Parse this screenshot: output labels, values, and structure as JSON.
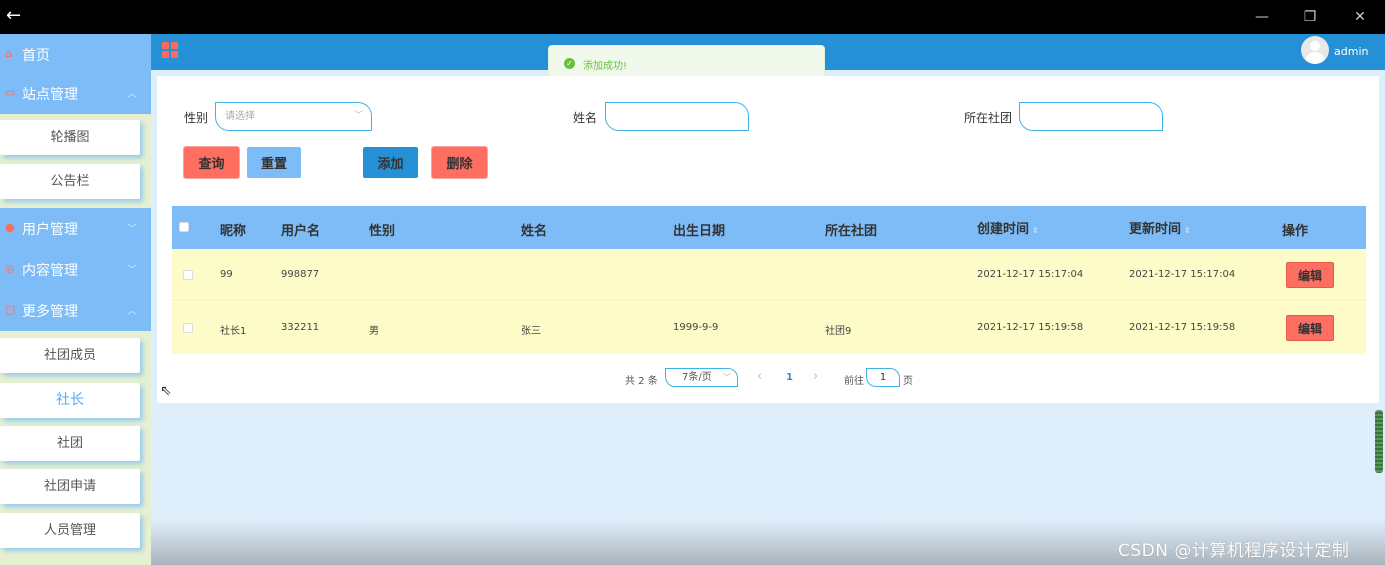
{
  "window": {
    "back_icon": "arrow-left-icon",
    "minimize": "—",
    "restore": "❐",
    "close": "✕"
  },
  "sidebar": {
    "groups": [
      {
        "label": "首页",
        "icon": "home-icon"
      },
      {
        "label": "站点管理",
        "icon": "monitor-icon",
        "items": [
          "轮播图",
          "公告栏"
        ]
      },
      {
        "label": "用户管理",
        "icon": "user-icon"
      },
      {
        "label": "内容管理",
        "icon": "content-icon"
      },
      {
        "label": "更多管理",
        "icon": "more-icon",
        "items": [
          "社团成员",
          "社长",
          "社团",
          "社团申请",
          "人员管理"
        ]
      }
    ],
    "active_item": "社长"
  },
  "header": {
    "username": "admin",
    "menu_icon": "grid-icon"
  },
  "toast": {
    "message": "添加成功!",
    "type": "success"
  },
  "filters": {
    "gender_label": "性别",
    "gender_placeholder": "请选择",
    "name_label": "姓名",
    "name_value": "",
    "club_label": "所在社团",
    "club_value": ""
  },
  "buttons": {
    "query": "查询",
    "reset": "重置",
    "add": "添加",
    "delete": "删除"
  },
  "table": {
    "headers": [
      "昵称",
      "用户名",
      "性别",
      "姓名",
      "出生日期",
      "所在社团",
      "创建时间",
      "更新时间",
      "操作"
    ],
    "rows": [
      [
        "99",
        "998877",
        "",
        "",
        "",
        "",
        "2021-12-17 15:17:04",
        "2021-12-17 15:17:04"
      ],
      [
        "社长1",
        "332211",
        "男",
        "张三",
        "1999-9-9",
        "社团9",
        "2021-12-17 15:19:58",
        "2021-12-17 15:19:58"
      ]
    ],
    "action_label": "编辑"
  },
  "pagination": {
    "total_text": "共 2 条",
    "page_size": "7条/页",
    "prev": "‹",
    "current_page": "1",
    "next": "›",
    "goto_label": "前往",
    "goto_value": "1",
    "page_suffix": "页"
  },
  "watermark": "CSDN @计算机程序设计定制",
  "colors": {
    "primary": "#2690d6",
    "light_blue": "#7dbcf7",
    "accent_red": "#ff6f61",
    "row_yellow": "#fdfbc8",
    "success": "#67c23a"
  }
}
